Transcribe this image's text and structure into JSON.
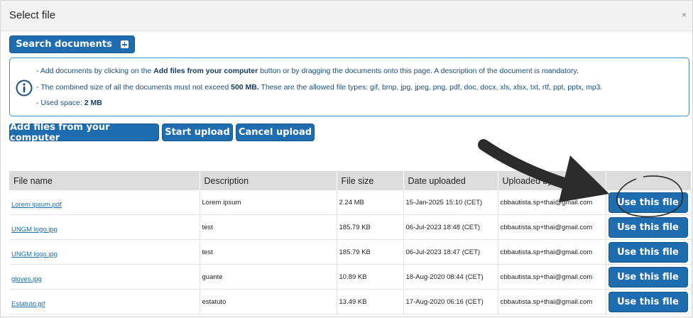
{
  "dialog": {
    "title": "Select file",
    "close_glyph": "×"
  },
  "toolbar": {
    "search_label": "Search documents",
    "add_files_label": "Add files from your computer",
    "start_upload_label": "Start upload",
    "cancel_upload_label": "Cancel upload"
  },
  "info": {
    "line1_pre": "- Add documents by clicking on the ",
    "line1_bold": "Add files from your computer",
    "line1_post": " button or by dragging the documents onto this page. A description of the document is mandatory.",
    "line2_pre": "- The combined size of all the documents must not exceed ",
    "line2_bold": "500 MB.",
    "line2_post": " These are the allowed file types: gif, bmp, jpg, jpeg, png, pdf, doc, docx, xls, xlsx, txt, rtf, ppt, pptx, mp3.",
    "line3_pre": "- Used space: ",
    "line3_bold": "2 MB"
  },
  "table": {
    "headers": [
      "File name",
      "Description",
      "File size",
      "Date uploaded",
      "Uploaded by",
      ""
    ],
    "use_label": "Use this file",
    "rows": [
      {
        "name": "Lorem ipsum.pdf",
        "description": "Lorem ipsum",
        "size": "2.24 MB",
        "date": "15-Jan-2025 15:10 (CET)",
        "by": "cbbautista.sp+thai@gmail.com"
      },
      {
        "name": "UNGM logo.jpg",
        "description": "test",
        "size": "185.79 KB",
        "date": "06-Jul-2023 18:48 (CET)",
        "by": "cbbautista.sp+thai@gmail.com"
      },
      {
        "name": "UNGM logo.jpg",
        "description": "test",
        "size": "185.79 KB",
        "date": "06-Jul-2023 18:47 (CET)",
        "by": "cbbautista.sp+thai@gmail.com"
      },
      {
        "name": "gloves.jpg",
        "description": "guante",
        "size": "10.89 KB",
        "date": "18-Aug-2020 08:44 (CET)",
        "by": "cbbautista.sp+thai@gmail.com"
      },
      {
        "name": "Estatuto.gif",
        "description": "estatuto",
        "size": "13.49 KB",
        "date": "17-Aug-2020 06:16 (CET)",
        "by": "cbbautista.sp+thai@gmail.com"
      }
    ]
  },
  "icons": {
    "info": "info-circle-icon",
    "plus": "plus-square-icon"
  },
  "colors": {
    "primary": "#1f6db1",
    "info_border": "#4a8cc6",
    "header_bg": "#dcdcdc",
    "annotation": "#2b2b2b"
  }
}
